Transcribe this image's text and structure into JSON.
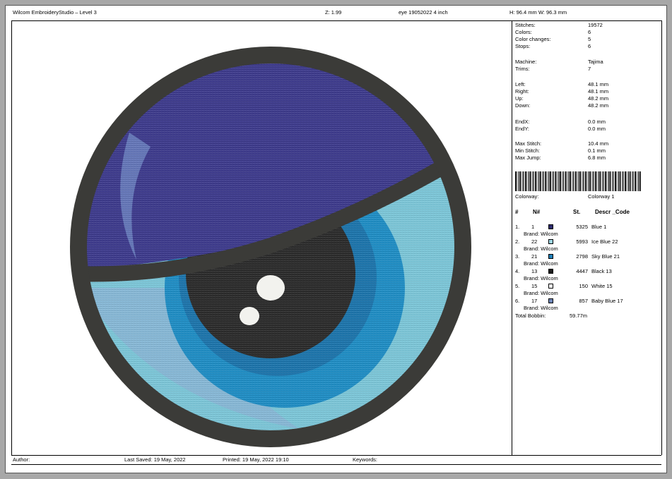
{
  "header": {
    "app_title": "Wilcom EmbroideryStudio – Level 3",
    "zoom": "Z: 1.99",
    "file_name": "eye 19052022 4 inch",
    "size": "H: 96.4 mm   W: 96.3 mm"
  },
  "stats": [
    {
      "label": "Stitches:",
      "value": "19572"
    },
    {
      "label": "Colors:",
      "value": "6"
    },
    {
      "label": "Color changes:",
      "value": "5"
    },
    {
      "label": "Stops:",
      "value": "6"
    },
    {
      "label": "Machine:",
      "value": "Tajima"
    },
    {
      "label": "Trims:",
      "value": "7"
    },
    {
      "label": "Left:",
      "value": "48.1 mm"
    },
    {
      "label": "Right:",
      "value": "48.1 mm"
    },
    {
      "label": "Up:",
      "value": "48.2 mm"
    },
    {
      "label": "Down:",
      "value": "48.2 mm"
    },
    {
      "label": "EndX:",
      "value": "0.0 mm"
    },
    {
      "label": "EndY:",
      "value": "0.0 mm"
    },
    {
      "label": "Max Stitch:",
      "value": "10.4 mm"
    },
    {
      "label": "Min Stitch:",
      "value": "0.1 mm"
    },
    {
      "label": "Max Jump:",
      "value": "6.8 mm"
    }
  ],
  "colorway": {
    "label": "Colorway:",
    "value": "Colorway 1"
  },
  "table_headers": {
    "idx": "#",
    "num": "N#",
    "st": "St.",
    "desc": "Descr _Code"
  },
  "threads": [
    {
      "idx": "1.",
      "num": "1",
      "color": "#2c2a6e",
      "st": "5325",
      "desc": "Blue 1",
      "brand": "Brand: Wilcom"
    },
    {
      "idx": "2.",
      "num": "22",
      "color": "#9fd6e4",
      "st": "5993",
      "desc": "Ice Blue 22",
      "brand": "Brand: Wilcom"
    },
    {
      "idx": "3.",
      "num": "21",
      "color": "#1f7fb8",
      "st": "2798",
      "desc": "Sky Blue 21",
      "brand": "Brand: Wilcom"
    },
    {
      "idx": "4.",
      "num": "13",
      "color": "#1b1b1b",
      "st": "4447",
      "desc": "Black 13",
      "brand": "Brand: Wilcom"
    },
    {
      "idx": "5.",
      "num": "15",
      "color": "#ffffff",
      "st": "150",
      "desc": "White 15",
      "brand": "Brand: Wilcom"
    },
    {
      "idx": "6.",
      "num": "17",
      "color": "#6e86b8",
      "st": "857",
      "desc": "Baby Blue 17",
      "brand": "Brand: Wilcom"
    }
  ],
  "total_bobbin": {
    "label": "Total Bobbin:",
    "value": "59.77m"
  },
  "footer": {
    "author": "Author:",
    "last_saved": "Last Saved: 19 May, 2022",
    "printed": "Printed: 19 May, 2022 19:10",
    "keywords": "Keywords:"
  },
  "colors": {
    "ring": "#3b3b38",
    "lid": "#3d3a8c",
    "iris_light": "#7cc6d8",
    "iris_mid": "#1f8dc4",
    "iris_dark": "#1c74ab",
    "pupil": "#2b2b2b",
    "highlight": "#f2f2ee"
  }
}
